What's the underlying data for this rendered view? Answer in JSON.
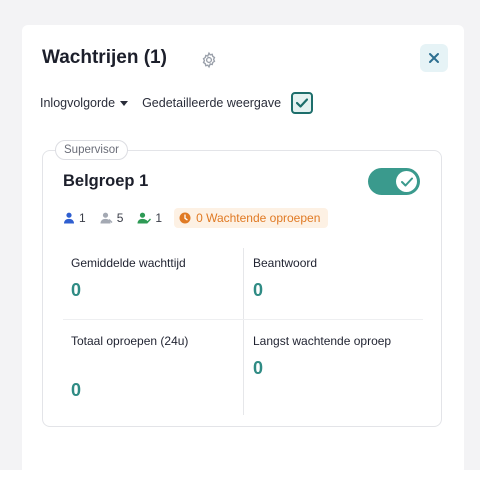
{
  "header": {
    "title": "Wachtrijen (1)"
  },
  "toolbar": {
    "order_label": "Inlogvolgorde",
    "detailed_label": "Gedetailleerde weergave",
    "detailed_checked": true
  },
  "queue": {
    "role": "Supervisor",
    "name": "Belgroep 1",
    "enabled": true,
    "stats": {
      "agents_available": "1",
      "agents_away": "5",
      "agents_on_call": "1"
    },
    "waiting_label": "0 Wachtende oproepen",
    "metrics": {
      "avg_wait_label": "Gemiddelde wachttijd",
      "avg_wait_value": "0",
      "answered_label": "Beantwoord",
      "answered_value": "0",
      "total_calls_label": "Totaal oproepen (24u)",
      "total_calls_value": "0",
      "longest_wait_label": "Langst wachtende oproep",
      "longest_wait_value": "0"
    }
  },
  "colors": {
    "accent": "#3a9a8d",
    "value_teal": "#2f8b84",
    "waiting_orange": "#e07a24",
    "agent_blue": "#2f5fd0",
    "agent_green": "#2e9a55"
  },
  "icons": {
    "settings": "gear-icon",
    "close": "close-icon",
    "available": "user-icon",
    "away": "user-away-icon",
    "on_call": "user-check-icon",
    "waiting": "clock-icon"
  }
}
